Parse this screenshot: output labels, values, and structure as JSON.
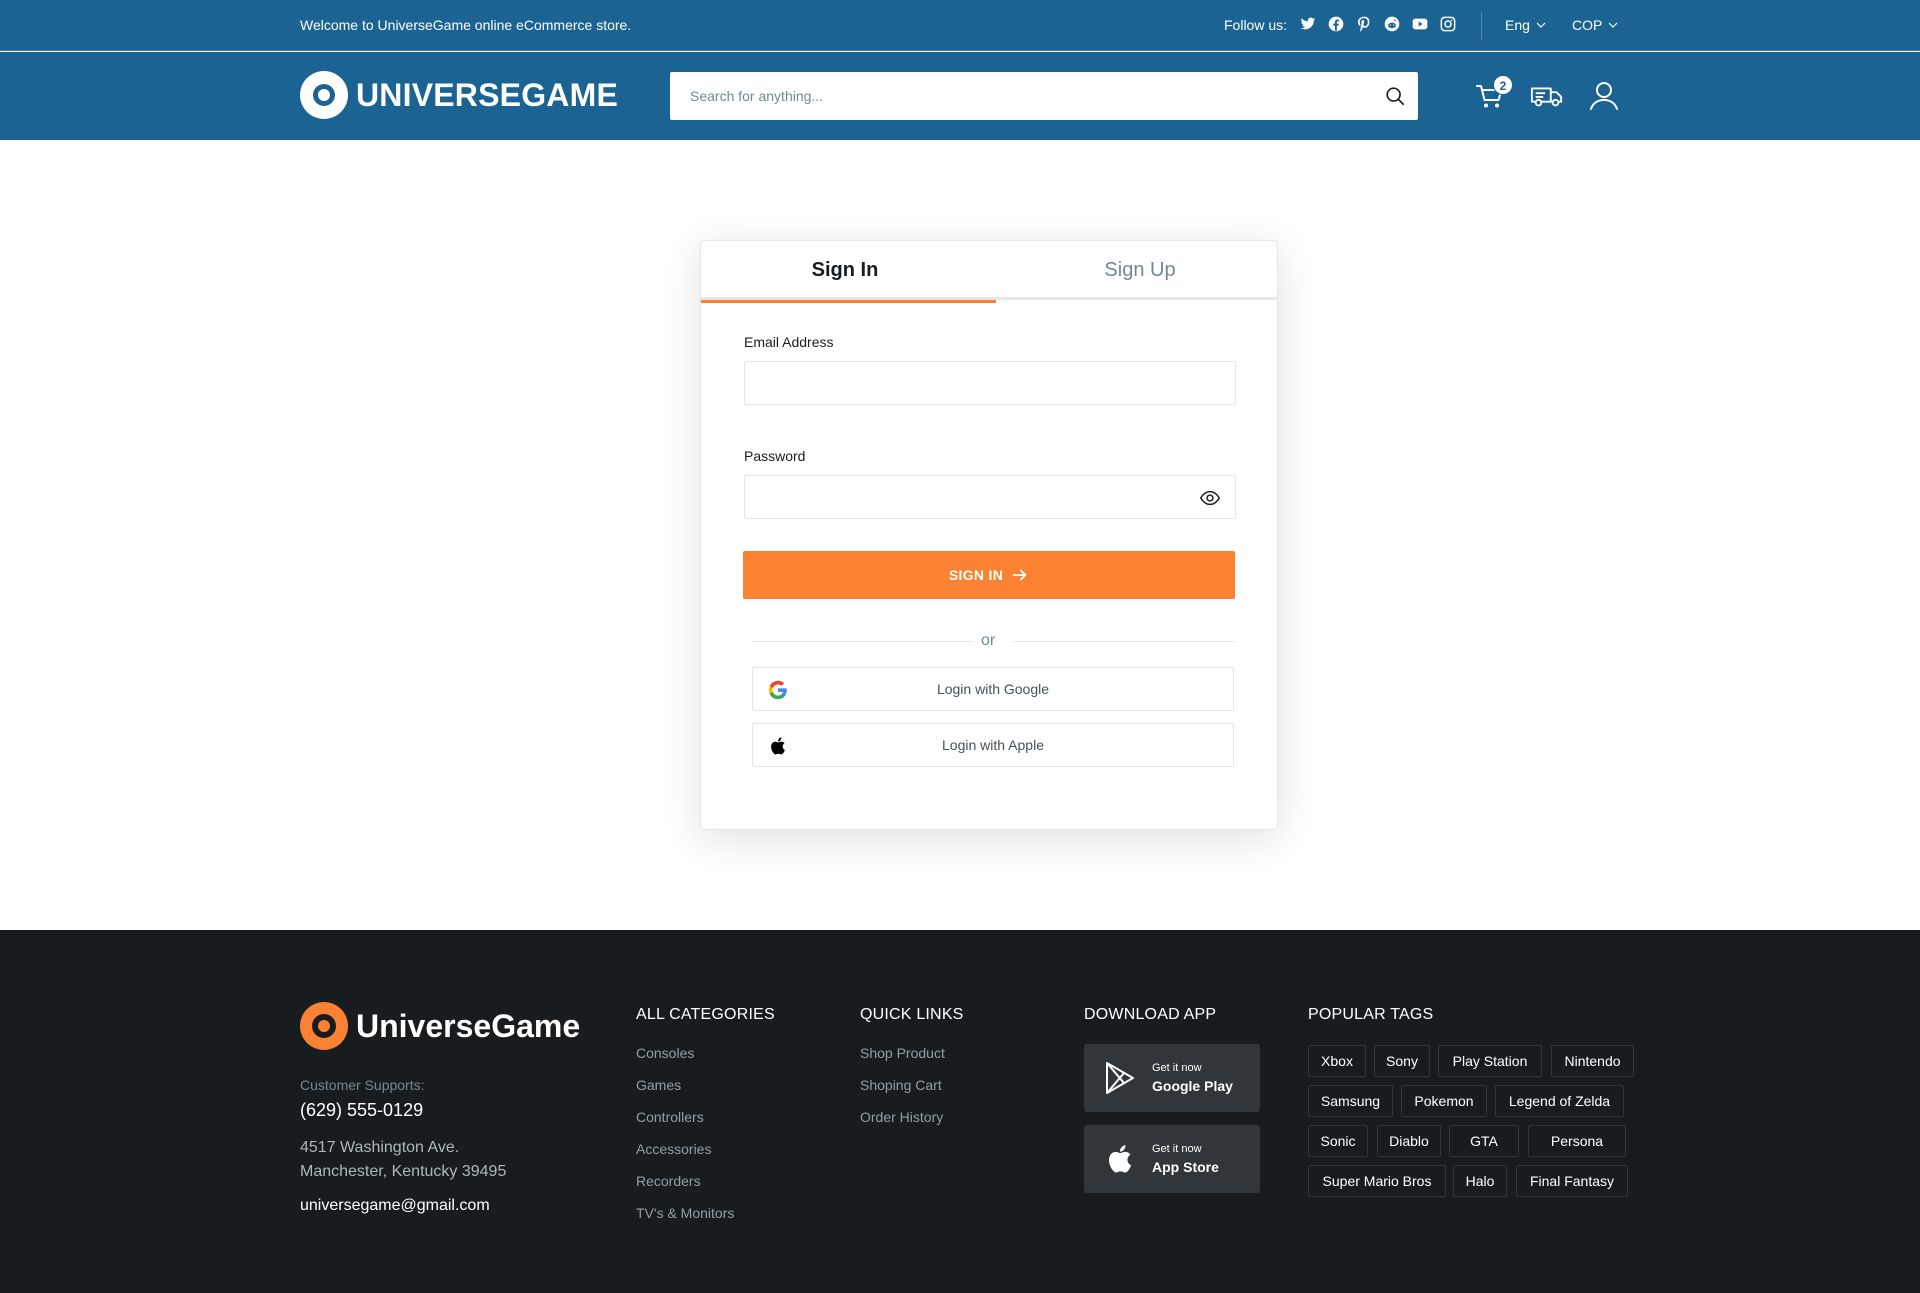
{
  "topbar": {
    "welcome": "Welcome to UniverseGame online eCommerce store.",
    "follow_label": "Follow us:",
    "socials": [
      "twitter-icon",
      "facebook-icon",
      "pinterest-icon",
      "reddit-icon",
      "youtube-icon",
      "instagram-icon"
    ],
    "language": "Eng",
    "currency": "COP"
  },
  "header": {
    "logo_text": "UNIVERSEGAME",
    "search_placeholder": "Search for anything...",
    "cart_count": "2"
  },
  "auth": {
    "tab_signin": "Sign In",
    "tab_signup": "Sign Up",
    "email_label": "Email Address",
    "password_label": "Password",
    "signin_button": "SIGN IN",
    "or_text": "or",
    "google_label": "Login with Google",
    "apple_label": "Login with Apple"
  },
  "footer": {
    "logo_text": "UniverseGame",
    "support_label": "Customer Supports:",
    "phone": "(629) 555-0129",
    "address_line1": "4517 Washington Ave.",
    "address_line2": "Manchester, Kentucky 39495",
    "email": "universegame@gmail.com",
    "categories_title": "ALL CATEGORIES",
    "categories": [
      "Consoles",
      "Games",
      "Controllers",
      "Accessories",
      "Recorders",
      "TV's & Monitors"
    ],
    "quick_title": "QUICK LINKS",
    "quick_links": [
      "Shop Product",
      "Shoping Cart",
      "Order History"
    ],
    "app_title": "DOWNLOAD APP",
    "google_play_small": "Get it now",
    "google_play_big": "Google Play",
    "app_store_small": "Get it now",
    "app_store_big": "App Store",
    "tags_title": "POPULAR TAGS",
    "tags": [
      "Xbox",
      "Sony",
      "Play Station",
      "Nintendo",
      "Samsung",
      "Pokemon",
      "Legend of Zelda",
      "Sonic",
      "Diablo",
      "GTA",
      "Persona",
      "Super Mario Bros",
      "Halo",
      "Final Fantasy"
    ]
  },
  "colors": {
    "brand_blue": "#1b6392",
    "accent_orange": "#fa8232",
    "footer_bg": "#191c1f"
  }
}
